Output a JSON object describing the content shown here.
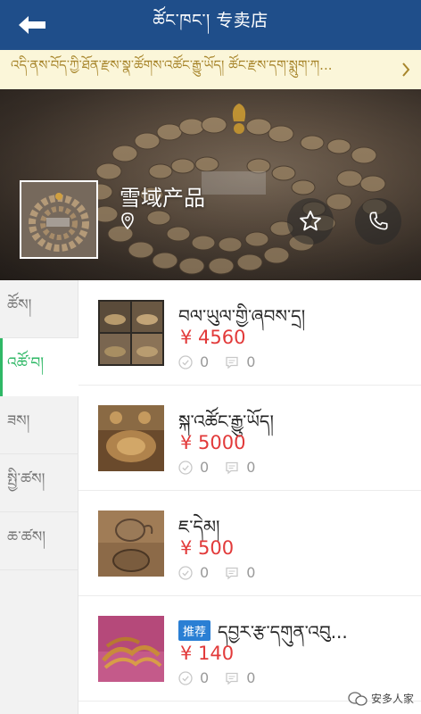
{
  "header": {
    "title": "ཚོང་ཁང་། 专卖店",
    "back_icon": "back-arrow-icon"
  },
  "notice": {
    "text": "འདི་ནས་བོད་ཀྱི་ཐོན་རྫས་སྣ་ཚོགས་འཚོང་རྒྱུ་ཡོད། ཚོང་རྫས་དག་སྨུག་ཀ...",
    "arrow_icon": "chevron-right-icon"
  },
  "banner": {
    "shop_name": "雪域产品",
    "fav_icon": "star-icon",
    "call_icon": "phone-icon",
    "location_icon": "location-pin-icon"
  },
  "categories": [
    {
      "label": "ཚོས།",
      "active": false
    },
    {
      "label": "འཚོ་བ།",
      "active": true
    },
    {
      "label": "ཟས།",
      "active": false
    },
    {
      "label": "སྤྱི་ཚས།",
      "active": false
    },
    {
      "label": "ཆ་ཚས།",
      "active": false
    }
  ],
  "products": [
    {
      "name": "བལ་ཡུལ་གྱི་ཞབས་དྲ།",
      "price": "¥ 4560",
      "views": "0",
      "comments": "0",
      "tag": ""
    },
    {
      "name": "སྐ་འཚོང་རྒྱུ་ཡོད།",
      "price": "¥ 5000",
      "views": "0",
      "comments": "0",
      "tag": ""
    },
    {
      "name": "ཇ་དེམ།",
      "price": "¥ 500",
      "views": "0",
      "comments": "0",
      "tag": ""
    },
    {
      "name": "དབྱར་རྩ་དགུན་འབུ...",
      "price": "¥ 140",
      "views": "0",
      "comments": "0",
      "tag": "推荐"
    }
  ],
  "watermark": {
    "text": "安多人家"
  },
  "colors": {
    "header_bg": "#1f4e8a",
    "accent_green": "#2fb866",
    "price_red": "#e23a3a",
    "tag_blue": "#2a7fd4",
    "notice_bg": "#fbf6d9"
  }
}
